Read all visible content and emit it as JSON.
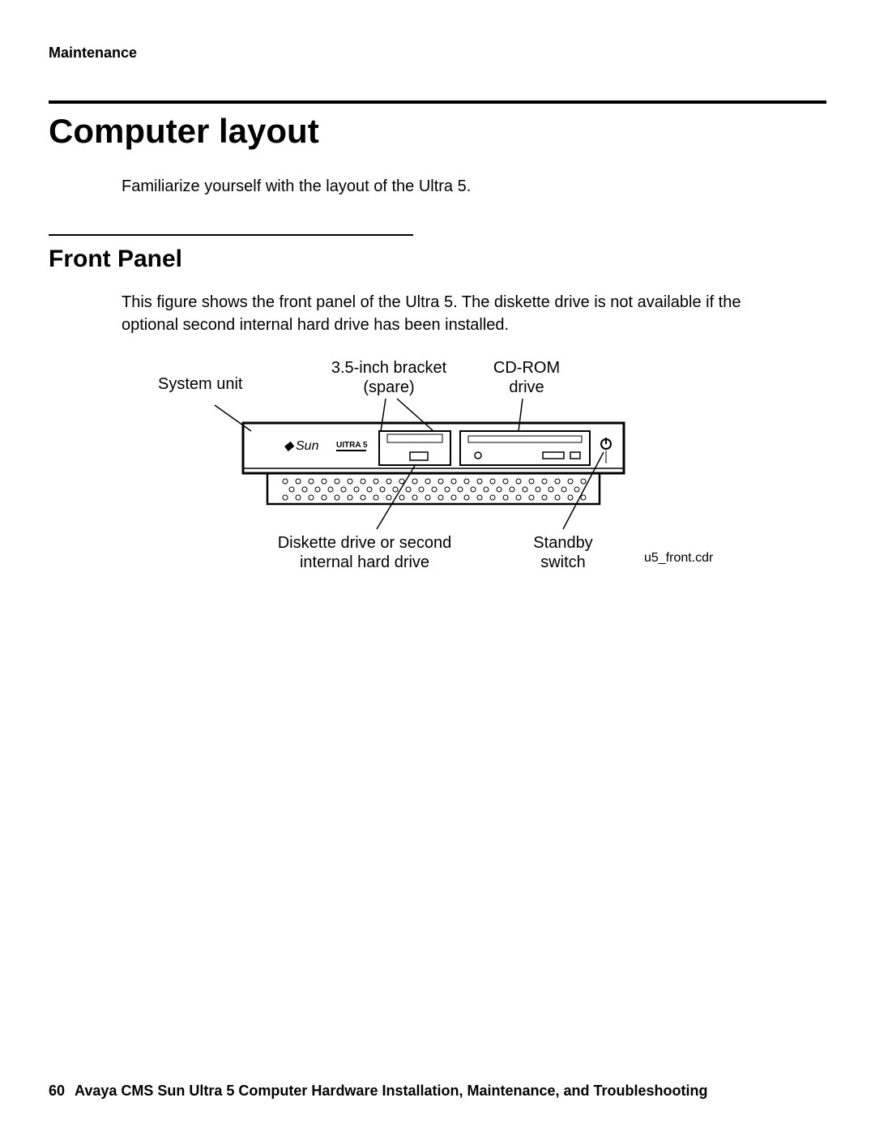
{
  "header": {
    "section_label": "Maintenance"
  },
  "title": "Computer layout",
  "intro_text": "Familiarize yourself with the layout of the Ultra 5.",
  "subsection_title": "Front Panel",
  "body_text": "This figure shows the front panel of the Ultra 5. The diskette drive is not available if the optional second internal hard drive has been installed.",
  "figure": {
    "callouts": {
      "system_unit": "System unit",
      "bracket_line1": "3.5-inch bracket",
      "bracket_line2": "(spare)",
      "cdrom_line1": "CD-ROM",
      "cdrom_line2": "drive",
      "diskette_line1": "Diskette drive or second",
      "diskette_line2": "internal hard drive",
      "standby_line1": "Standby",
      "standby_line2": "switch"
    },
    "brand_text": "Sun",
    "model_text": "UITRA 5",
    "file_label": "u5_front.cdr"
  },
  "footer": {
    "page_number": "60",
    "doc_title": "Avaya CMS Sun Ultra 5 Computer Hardware Installation, Maintenance, and Troubleshooting"
  }
}
